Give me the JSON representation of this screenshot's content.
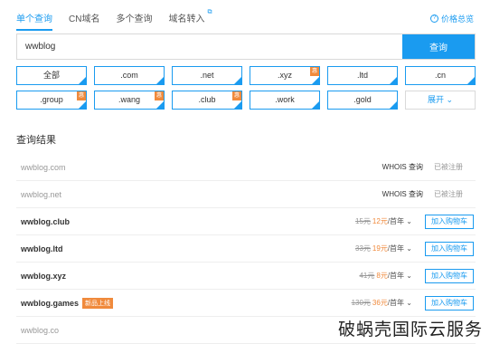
{
  "tabs": [
    {
      "label": "单个查询"
    },
    {
      "label": "CN域名"
    },
    {
      "label": "多个查询"
    },
    {
      "label": "域名转入",
      "ext": "⧉"
    }
  ],
  "price_link": {
    "label": "价格总览",
    "icon": "question-circle-icon"
  },
  "search": {
    "value": "wwblog",
    "button": "查询"
  },
  "tlds": [
    {
      "label": "全部",
      "selected": true
    },
    {
      "label": ".com",
      "selected": true
    },
    {
      "label": ".net",
      "selected": true
    },
    {
      "label": ".xyz",
      "selected": true,
      "badge": "惠"
    },
    {
      "label": ".ltd",
      "selected": true
    },
    {
      "label": ".cn",
      "selected": true
    },
    {
      "label": ".group",
      "selected": true,
      "badge": "惠"
    },
    {
      "label": ".wang",
      "selected": true,
      "badge": "惠"
    },
    {
      "label": ".club",
      "selected": true,
      "badge": "惠"
    },
    {
      "label": ".work",
      "selected": true
    },
    {
      "label": ".gold",
      "selected": true
    },
    {
      "label": "展开 ⌄",
      "selected": false,
      "more": true
    }
  ],
  "results_title": "查询结果",
  "results": [
    {
      "name": "wwblog",
      "tld": ".com",
      "taken": true,
      "whois": "WHOIS 查询",
      "status": "已被注册"
    },
    {
      "name": "wwblog",
      "tld": ".net",
      "taken": true,
      "whois": "WHOIS 查询",
      "status": "已被注册"
    },
    {
      "name": "wwblog",
      "tld": ".club",
      "taken": false,
      "old": "15元",
      "now": "12元",
      "unit": "/首年",
      "cart": "加入购物车"
    },
    {
      "name": "wwblog",
      "tld": ".ltd",
      "taken": false,
      "old": "33元",
      "now": "19元",
      "unit": "/首年",
      "cart": "加入购物车"
    },
    {
      "name": "wwblog",
      "tld": ".xyz",
      "taken": false,
      "old": "41元",
      "now": "8元",
      "unit": "/首年",
      "cart": "加入购物车"
    },
    {
      "name": "wwblog",
      "tld": ".games",
      "taken": false,
      "tag": "新品上线",
      "old": "130元",
      "now": "36元",
      "unit": "/首年",
      "cart": "加入购物车"
    },
    {
      "name": "wwblog",
      "tld": ".co",
      "taken": true,
      "whois": "",
      "status": ""
    }
  ],
  "watermark": "破蜗壳国际云服务",
  "colors": {
    "accent": "#1a9bf0",
    "badge": "#f08a3c"
  }
}
